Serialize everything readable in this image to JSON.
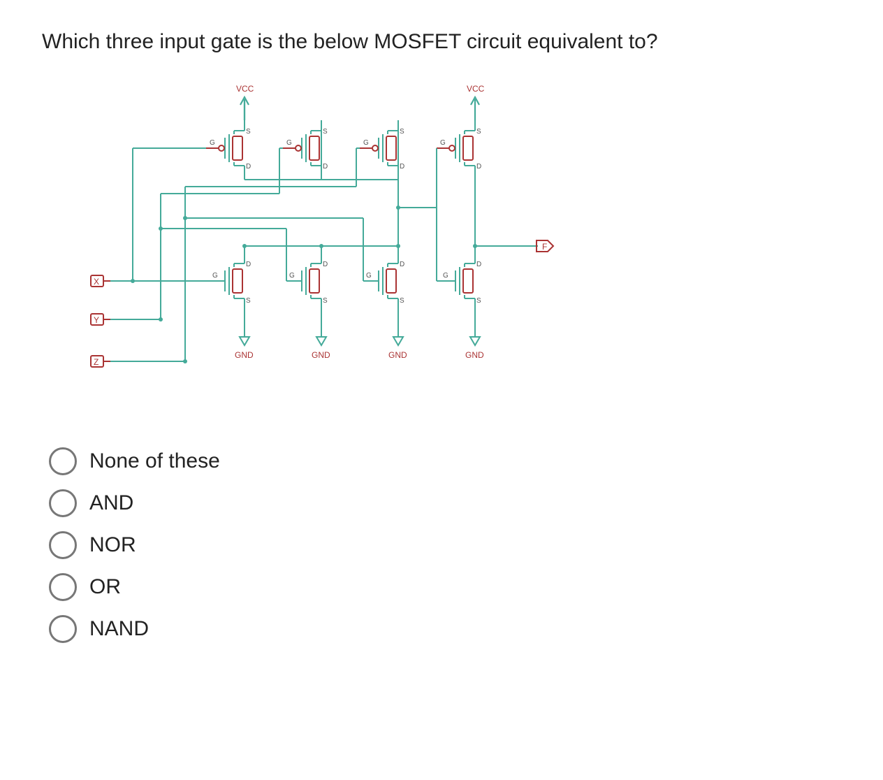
{
  "question_text": "Which three input gate is the below MOSFET circuit equivalent to?",
  "options": [
    {
      "id": "opt-none",
      "label": "None of these"
    },
    {
      "id": "opt-and",
      "label": "AND"
    },
    {
      "id": "opt-nor",
      "label": "NOR"
    },
    {
      "id": "opt-or",
      "label": "OR"
    },
    {
      "id": "opt-nand",
      "label": "NAND"
    }
  ],
  "circuit": {
    "inputs": [
      "X",
      "Y",
      "Z"
    ],
    "output": "F",
    "supply_labels": [
      "VCC",
      "VCC"
    ],
    "ground_labels": [
      "GND",
      "GND",
      "GND",
      "GND"
    ],
    "terminal_labels": {
      "gate": "G",
      "source": "S",
      "drain": "D"
    },
    "pmos_count": 4,
    "nmos_count": 4
  }
}
